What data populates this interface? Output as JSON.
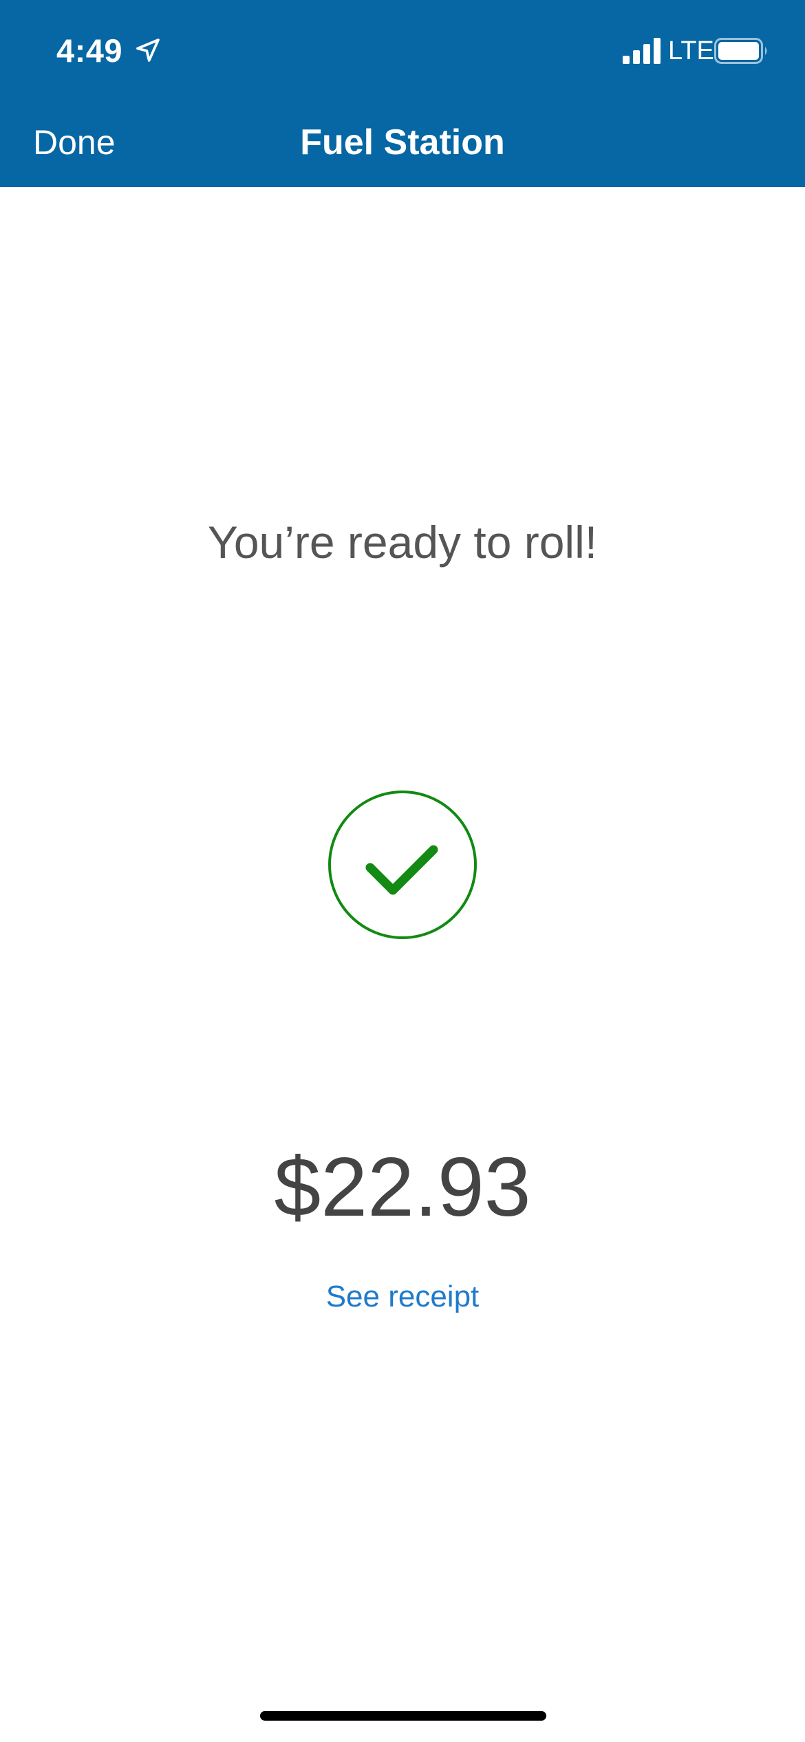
{
  "status_bar": {
    "time": "4:49",
    "network": "LTE",
    "icons": [
      "location-arrow-icon",
      "cellular-signal-icon",
      "battery-icon"
    ]
  },
  "nav": {
    "done_label": "Done",
    "title": "Fuel Station"
  },
  "main": {
    "heading": "You’re ready to roll!",
    "status_icon": "checkmark-circle-icon",
    "amount": "$22.93",
    "receipt_link": "See receipt"
  },
  "colors": {
    "header_background": "#0667a4",
    "success_green": "#138a13",
    "link_blue": "#1f7acb",
    "text_gray": "#555555"
  }
}
